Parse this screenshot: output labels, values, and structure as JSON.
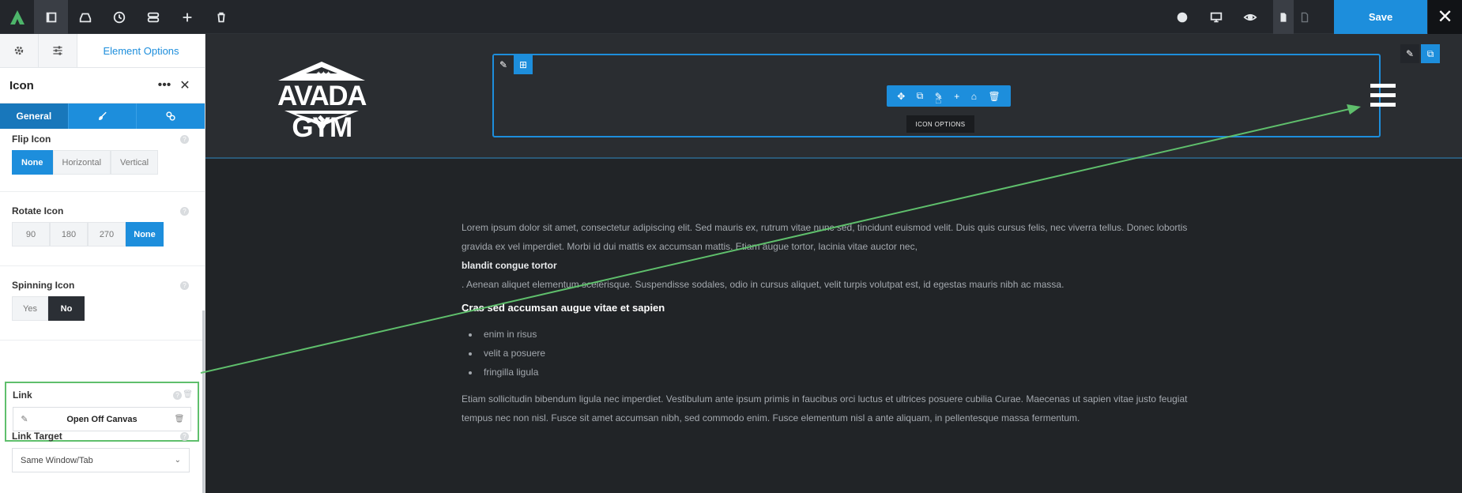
{
  "toolbar": {
    "save_label": "Save"
  },
  "sidebar": {
    "panel_title": "Element Options",
    "element_name": "Icon",
    "subtabs": [
      "General"
    ],
    "flip_icon": {
      "label": "Flip Icon",
      "options": [
        "None",
        "Horizontal",
        "Vertical"
      ],
      "selected": "None"
    },
    "rotate_icon": {
      "label": "Rotate Icon",
      "options": [
        "90",
        "180",
        "270",
        "None"
      ],
      "selected": "None"
    },
    "spinning_icon": {
      "label": "Spinning Icon",
      "options": [
        "Yes",
        "No"
      ],
      "selected": "No"
    },
    "link": {
      "label": "Link",
      "value": "Open Off Canvas"
    },
    "link_target": {
      "label": "Link Target",
      "value": "Same Window/Tab"
    }
  },
  "canvas": {
    "logo_text": "AVADA GYM",
    "tooltip": "ICON OPTIONS",
    "paragraph1": "Lorem ipsum dolor sit amet, consectetur adipiscing elit. Sed mauris ex, rutrum vitae nunc sed, tincidunt euismod velit. Duis quis cursus felis, nec viverra tellus. Donec lobortis gravida ex vel imperdiet. Morbi id dui mattis ex accumsan mattis. Etiam augue tortor, lacinia vitae auctor nec,",
    "bold_line": "blandit congue tortor",
    "paragraph2": ". Aenean aliquet elementum scelerisque. Suspendisse sodales, odio in cursus aliquet, velit turpis volutpat est, id egestas mauris nibh ac massa.",
    "heading": "Cras sed accumsan augue vitae et sapien",
    "list": [
      "enim in risus",
      "velit a posuere",
      "fringilla ligula"
    ],
    "paragraph3": "Etiam sollicitudin bibendum ligula nec imperdiet. Vestibulum ante ipsum primis in faucibus orci luctus et ultrices posuere cubilia Curae. Maecenas ut sapien vitae justo feugiat tempus nec non nisl. Fusce sit amet accumsan nibh, sed commodo enim. Fusce elementum nisl a ante aliquam, in pellentesque massa fermentum."
  },
  "colors": {
    "accent": "#1d8edc",
    "annotation_arrow": "#5fbf6c",
    "canvas_bg": "#212427"
  }
}
